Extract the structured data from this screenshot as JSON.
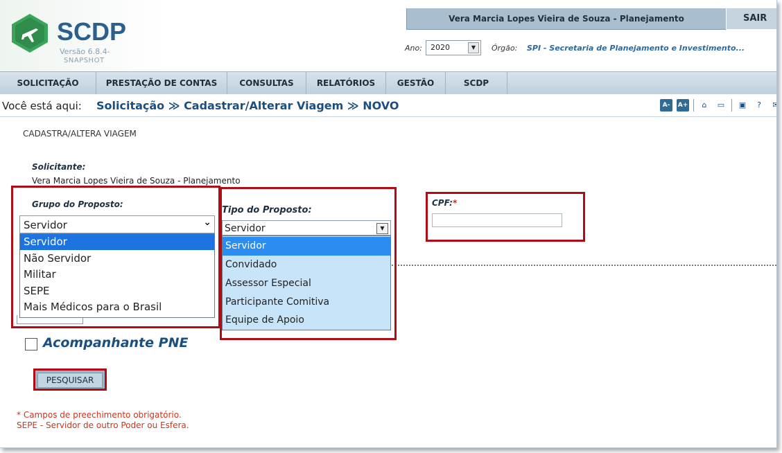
{
  "header": {
    "logo_text": "SCDP",
    "version": "Versão 6.8.4-",
    "snapshot": "SNAPSHOT",
    "user_name": "Vera Marcia Lopes Vieira de Souza - Planejamento",
    "logout": "SAIR",
    "ano_label": "Ano:",
    "ano_value": "2020",
    "orgao_label": "Órgão:",
    "orgao_value": "SPI - Secretaria de Planejamento e Investimento..."
  },
  "menu": {
    "items": [
      {
        "label": "SOLICITAÇÃO"
      },
      {
        "label": "PRESTAÇÃO DE CONTAS"
      },
      {
        "label": "CONSULTAS"
      },
      {
        "label": "RELATÓRIOS"
      },
      {
        "label": "GESTÃO"
      },
      {
        "label": "SCDP"
      }
    ]
  },
  "breadcrumb": {
    "prefix": "Você está aqui:",
    "path": "Solicitação ≫ Cadastrar/Alterar Viagem ≫ NOVO"
  },
  "toolbar": {
    "font_decrease": "A-",
    "font_increase": "A+",
    "icons": [
      "home-icon",
      "chat-icon",
      "video-icon",
      "help-icon",
      "mail-icon"
    ]
  },
  "form": {
    "heading": "CADASTRA/ALTERA VIAGEM",
    "solicitante_label": "Solicitante:",
    "solicitante_value": "Vera Marcia Lopes Vieira de Souza - Planejamento",
    "grupo_label": "Grupo do Proposto:",
    "grupo_selected": "Servidor",
    "grupo_options": [
      "Servidor",
      "Não Servidor",
      "Militar",
      "SEPE",
      "Mais Médicos para o Brasil"
    ],
    "tipo_label": "Tipo do Proposto:",
    "tipo_selected": "Servidor",
    "tipo_options": [
      "Servidor",
      "Convidado",
      "Assessor Especial",
      "Participante Comitiva",
      "Equipe de Apoio"
    ],
    "cpf_label": "CPF:",
    "cpf_required": "*",
    "cpf_value": "",
    "pne_label": "Acompanhante PNE",
    "pne_checked": false,
    "search_button": "PESQUISAR",
    "note_required": "* Campos de preechimento obrigatório.",
    "note_sepe": "SEPE - Servidor de outro Poder ou Esfera."
  },
  "colors": {
    "brand_blue": "#2b5f8c",
    "highlight_red": "#b00c16",
    "selected_blue": "#1d73e0",
    "note_red": "#c8361f"
  }
}
